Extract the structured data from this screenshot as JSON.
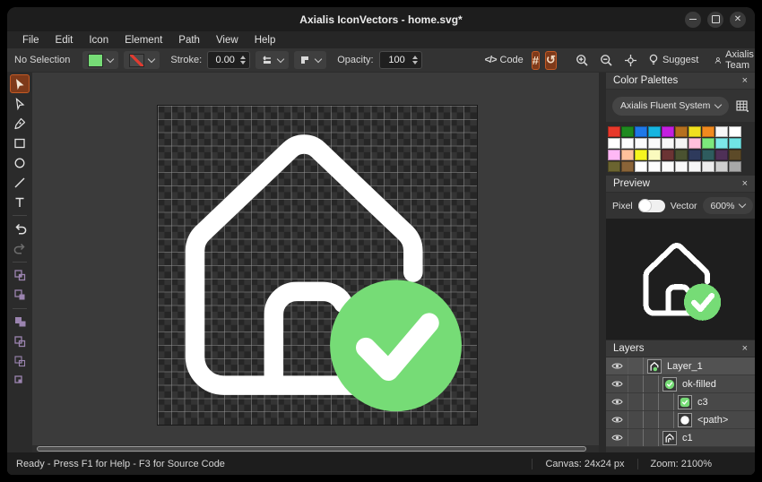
{
  "window": {
    "title": "Axialis IconVectors - home.svg*",
    "controls": [
      "minimize",
      "maximize",
      "close"
    ]
  },
  "menu": {
    "items": [
      "File",
      "Edit",
      "Icon",
      "Element",
      "Path",
      "View",
      "Help"
    ]
  },
  "toolbar": {
    "selection_status": "No Selection",
    "stroke_label": "Stroke:",
    "stroke_width": "0.00",
    "opacity_label": "Opacity:",
    "opacity_value": "100",
    "code_label": "Code",
    "code_glyph": "</>",
    "grid_glyph": "#",
    "rotate_glyph": "↺",
    "suggest_label": "Suggest",
    "account_label": "Axialis Team",
    "fill_color": "#76dc76",
    "stroke_none_color": "#e23b30",
    "active_button_bg": "#7e3a1a",
    "active_button_border": "#c35a25"
  },
  "tools": {
    "items": [
      "select",
      "direct-select",
      "pen-node",
      "rectangle",
      "ellipse",
      "line",
      "text",
      "undo",
      "redo",
      "boolean-exclude",
      "boolean-merge",
      "boolean-union",
      "boolean-subtract",
      "boolean-intersect",
      "boolean-divide"
    ],
    "active": "select",
    "boolean_icon_color": "#9b84b0"
  },
  "color_palettes": {
    "title": "Color Palettes",
    "selected_palette": "Axialis Fluent System",
    "close_glyph": "×",
    "swatches": [
      "#e8392b",
      "#1f8a1f",
      "#1f78e8",
      "#17b5e0",
      "#c41fe0",
      "#b5701f",
      "#f0e01f",
      "#f08a1f",
      "#f7f7f7",
      "#ffffff",
      "#ffffff",
      "#fdfdfd",
      "#fbfbfb",
      "#fafafa",
      "#f8f8f8",
      "#f5f5f5",
      "#ffc0dc",
      "#7ce87c",
      "#7ce8e8",
      "#70e4e4",
      "#ffb8f5",
      "#ffc09a",
      "#f5f51f",
      "#fafabe",
      "#6b3434",
      "#4a5230",
      "#2e3a5c",
      "#2e5c5e",
      "#4f3057",
      "#5c4a28",
      "#6b6430",
      "#8a6438",
      "#ffffff",
      "#fdfdfd",
      "#fbfbfb",
      "#f9f9f9",
      "#f7f7f7",
      "#ededed",
      "#cfcfcf",
      "#a8a8a8"
    ]
  },
  "preview": {
    "title": "Preview",
    "pixel_label": "Pixel",
    "vector_label": "Vector",
    "mode": "Pixel",
    "zoom": "600%",
    "close_glyph": "×"
  },
  "layers": {
    "title": "Layers",
    "close_glyph": "×",
    "items": [
      {
        "label": "Layer_1",
        "thumb": "home-with-green-dot",
        "indent": 1,
        "selected": true
      },
      {
        "label": "ok-filled",
        "thumb": "green-check-circle",
        "indent": 2,
        "selected": false
      },
      {
        "label": "c3",
        "thumb": "green-check-square",
        "indent": 3,
        "selected": false
      },
      {
        "label": "<path>",
        "thumb": "white-circle",
        "indent": 3,
        "selected": false
      },
      {
        "label": "c1",
        "thumb": "home-outline",
        "indent": 2,
        "selected": false
      }
    ]
  },
  "canvas": {
    "icon": "home-with-check",
    "grid_cells": 24,
    "accent_green": "#76dc76",
    "icon_stroke": "#ffffff"
  },
  "status": {
    "message": "Ready - Press F1 for Help - F3 for Source Code",
    "canvas_size": "Canvas: 24x24 px",
    "zoom": "Zoom: 2100%"
  }
}
